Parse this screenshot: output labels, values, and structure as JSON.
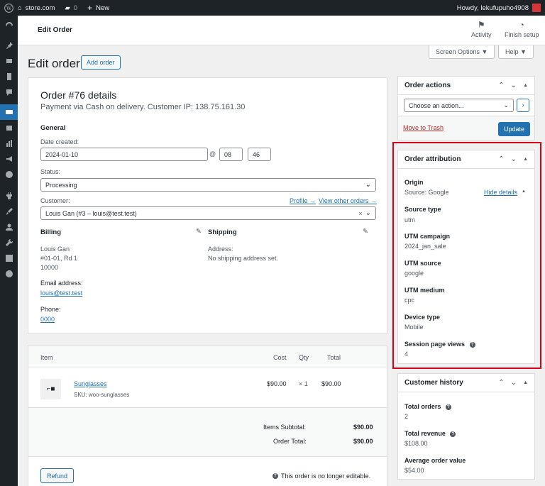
{
  "adminbar": {
    "site": "store.com",
    "comments": "0",
    "new": "New",
    "howdy": "Howdy, lekufupuho4908"
  },
  "topbar": {
    "title": "Edit Order",
    "activity": "Activity",
    "finish_setup": "Finish setup"
  },
  "screen_options": "Screen Options ▼",
  "help": "Help ▼",
  "page": {
    "heading": "Edit order",
    "add_order": "Add order"
  },
  "order": {
    "title": "Order #76 details",
    "subtitle": "Payment via Cash on delivery. Customer IP: 138.75.161.30",
    "general": "General",
    "date_label": "Date created:",
    "date": "2024-01-10",
    "at": "@",
    "hour": "08",
    "minute": "46",
    "status_label": "Status:",
    "status": "Processing",
    "customer_label": "Customer:",
    "profile_link": "Profile →",
    "other_orders_link": "View other orders →",
    "customer": "Louis Gan (#3 – louis@test.test)",
    "clear": "×",
    "billing_title": "Billing",
    "billing_address": [
      "Louis Gan",
      "#01-01, Rd 1",
      "10000"
    ],
    "email_label": "Email address:",
    "email": "louis@test.test",
    "phone_label": "Phone:",
    "phone": "0000",
    "shipping_title": "Shipping",
    "shipping_address_label": "Address:",
    "shipping_address": "No shipping address set."
  },
  "items": {
    "headers": {
      "item": "Item",
      "cost": "Cost",
      "qty": "Qty",
      "total": "Total"
    },
    "row": {
      "name": "Sunglasses",
      "sku": "SKU: woo-sunglasses",
      "cost": "$90.00",
      "qty": "× 1",
      "total": "$90.00"
    },
    "subtotal_label": "Items Subtotal:",
    "subtotal": "$90.00",
    "total_label": "Order Total:",
    "total": "$90.00",
    "refund": "Refund",
    "not_editable": "This order is no longer editable."
  },
  "order_actions": {
    "title": "Order actions",
    "select": "Choose an action...",
    "trash": "Move to Trash",
    "update": "Update"
  },
  "attribution": {
    "title": "Order attribution",
    "origin_label": "Origin",
    "origin_value": "Source: Google",
    "hide_details": "Hide details",
    "source_type_label": "Source type",
    "source_type": "utm",
    "utm_campaign_label": "UTM campaign",
    "utm_campaign": "2024_jan_sale",
    "utm_source_label": "UTM source",
    "utm_source": "google",
    "utm_medium_label": "UTM medium",
    "utm_medium": "cpc",
    "device_type_label": "Device type",
    "device_type": "Mobile",
    "session_views_label": "Session page views",
    "session_views": "4"
  },
  "customer_history": {
    "title": "Customer history",
    "total_orders_label": "Total orders",
    "total_orders": "2",
    "total_revenue_label": "Total revenue",
    "total_revenue": "$108.00",
    "aov_label": "Average order value",
    "aov": "$54.00"
  },
  "colors": {
    "accent": "#2271b1",
    "highlight": "#d9001b",
    "adminbar": "#1d2327"
  }
}
